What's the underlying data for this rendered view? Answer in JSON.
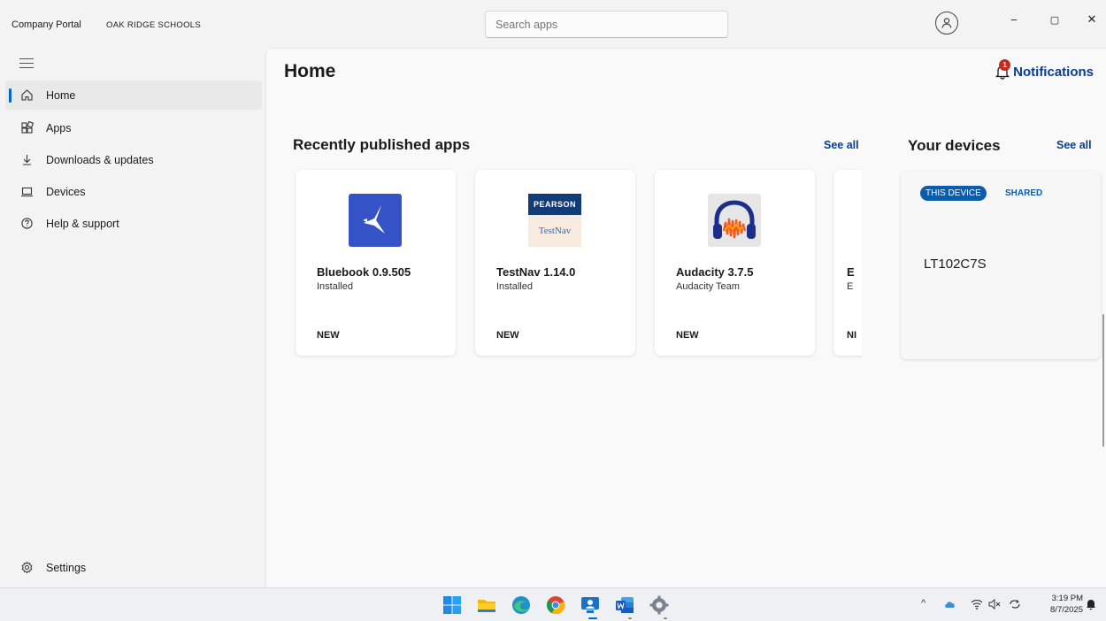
{
  "window": {
    "app_name": "Company Portal",
    "org_name": "OAK RIDGE SCHOOLS",
    "search_placeholder": "Search apps",
    "minimize_glyph": "−",
    "restore_glyph": "▢",
    "close_glyph": "✕"
  },
  "sidebar": {
    "items": [
      {
        "label": "Home",
        "icon": "home-icon",
        "active": true
      },
      {
        "label": "Apps",
        "icon": "apps-grid-icon",
        "active": false
      },
      {
        "label": "Downloads & updates",
        "icon": "download-icon",
        "active": false
      },
      {
        "label": "Devices",
        "icon": "laptop-icon",
        "active": false
      },
      {
        "label": "Help & support",
        "icon": "help-icon",
        "active": false
      }
    ],
    "settings_label": "Settings"
  },
  "main": {
    "title": "Home",
    "notifications": {
      "label": "Notifications",
      "count": "1"
    },
    "recent": {
      "title": "Recently published apps",
      "see_all": "See all",
      "apps": [
        {
          "name": "Bluebook 0.9.505",
          "sub": "Installed",
          "tag": "NEW",
          "icon": "bluebook-icon"
        },
        {
          "name": "TestNav 1.14.0",
          "sub": "Installed",
          "tag": "NEW",
          "icon": "testnav-icon",
          "logo_top": "PEARSON",
          "logo_bottom": "TestNav"
        },
        {
          "name": "Audacity 3.7.5",
          "sub": "Audacity Team",
          "tag": "NEW",
          "icon": "audacity-icon"
        },
        {
          "name": "E",
          "sub": "E",
          "tag": "NI",
          "icon": "app-icon"
        }
      ]
    },
    "devices": {
      "title": "Your devices",
      "see_all": "See all",
      "this_device_label": "THIS DEVICE",
      "shared_label": "SHARED",
      "device_name": "LT102C7S"
    }
  },
  "taskbar": {
    "apps": [
      "windows-start-icon",
      "file-explorer-icon",
      "edge-icon",
      "chrome-icon",
      "company-portal-icon",
      "word-icon",
      "settings-icon"
    ],
    "time": "3:19 PM",
    "date": "8/7/2025"
  },
  "colors": {
    "accent": "#0067c0",
    "link": "#0a3d91",
    "badge": "#c42b1c"
  }
}
